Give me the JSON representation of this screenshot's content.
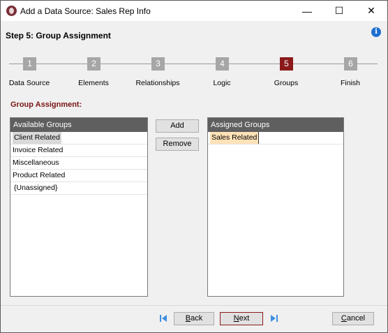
{
  "window": {
    "title": "Add a Data Source: Sales Rep Info",
    "minimize_glyph": "—",
    "maximize_glyph": "☐",
    "close_glyph": "✕"
  },
  "header": {
    "step_title": "Step 5: Group Assignment",
    "info_glyph": "i"
  },
  "wizard": {
    "steps": [
      {
        "number": "1",
        "label": "Data Source"
      },
      {
        "number": "2",
        "label": "Elements"
      },
      {
        "number": "3",
        "label": "Relationships"
      },
      {
        "number": "4",
        "label": "Logic"
      },
      {
        "number": "5",
        "label": "Groups"
      },
      {
        "number": "6",
        "label": "Finish"
      }
    ],
    "active_step": 5
  },
  "section_title": "Group Assignment:",
  "available": {
    "header": "Available Groups",
    "items": [
      "Client Related",
      "Invoice Related",
      "Miscellaneous",
      "Product Related",
      "{Unassigned}"
    ],
    "selected_index": 0
  },
  "assigned": {
    "header": "Assigned Groups",
    "items": [
      "Sales Related"
    ],
    "selected_index": 0
  },
  "buttons": {
    "add": "Add",
    "remove": "Remove",
    "back_first": "B",
    "back_rest": "ack",
    "next_first": "N",
    "next_rest": "ext",
    "cancel_first": "C",
    "cancel_rest": "ancel"
  },
  "colors": {
    "active_step": "#8b1a1a",
    "inactive_step": "#a6a6a6",
    "section_title": "#7a1515",
    "list_header": "#5f5f5f",
    "assigned_selection": "#ffe2b8",
    "nav_arrows": "#3d8fe0"
  },
  "icons": {
    "app": "app-logo-icon",
    "info": "info-icon",
    "first": "skip-first-icon",
    "last": "skip-last-icon"
  }
}
